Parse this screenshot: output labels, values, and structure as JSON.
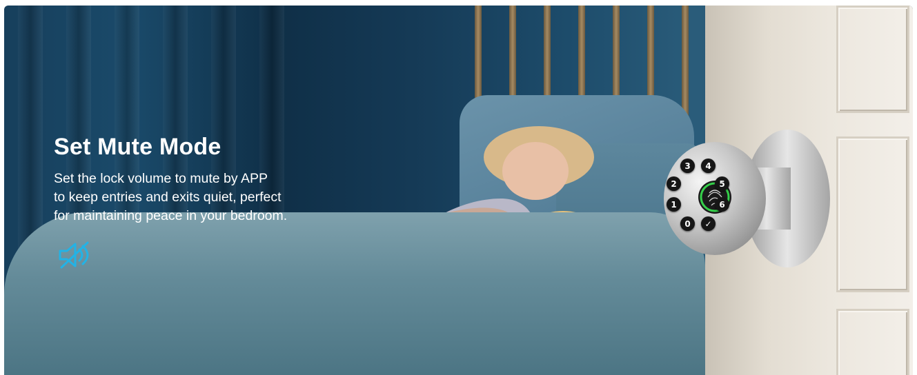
{
  "banner": {
    "title": "Set Mute Mode",
    "description_lines": [
      "Set the lock volume to mute by APP",
      "to keep entries and exits quiet, perfect",
      "for maintaining peace in your bedroom."
    ],
    "icon": "speaker-muted-icon",
    "accent_color": "#22b3e6"
  },
  "keypad": {
    "keys": [
      "3",
      "4",
      "2",
      "5",
      "1",
      "6",
      "0",
      "✓"
    ],
    "center_icon": "fingerprint-icon",
    "ring_color": "#35d04a"
  }
}
